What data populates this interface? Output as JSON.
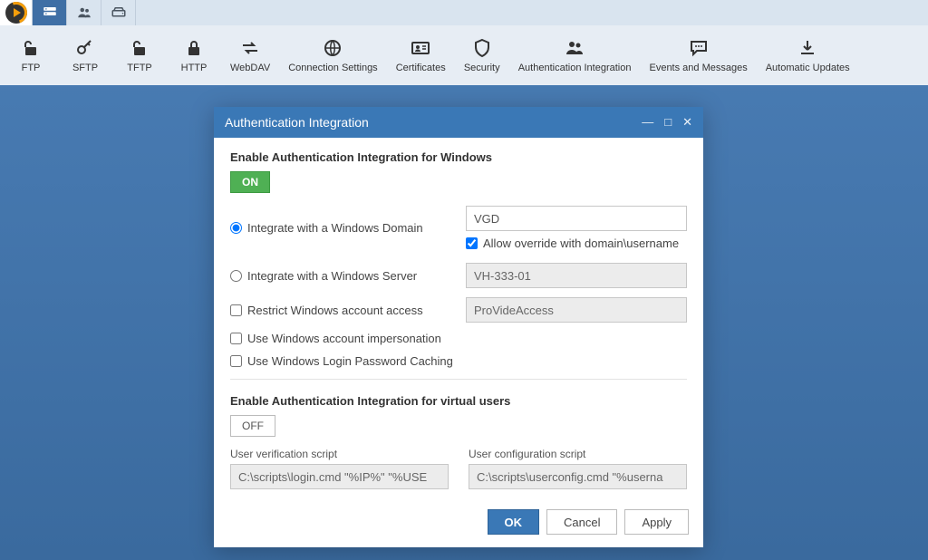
{
  "top_tabs": {
    "logo": "play-logo",
    "items": [
      "server-tab",
      "users-tab",
      "storage-tab"
    ]
  },
  "toolbar": {
    "items": [
      {
        "label": "FTP",
        "icon": "unlock"
      },
      {
        "label": "SFTP",
        "icon": "key"
      },
      {
        "label": "TFTP",
        "icon": "unlock"
      },
      {
        "label": "HTTP",
        "icon": "lock"
      },
      {
        "label": "WebDAV",
        "icon": "transfer"
      },
      {
        "label": "Connection Settings",
        "icon": "globe"
      },
      {
        "label": "Certificates",
        "icon": "id-card"
      },
      {
        "label": "Security",
        "icon": "shield"
      },
      {
        "label": "Authentication Integration",
        "icon": "users"
      },
      {
        "label": "Events and Messages",
        "icon": "chat"
      },
      {
        "label": "Automatic Updates",
        "icon": "download"
      }
    ]
  },
  "dialog": {
    "title": "Authentication Integration",
    "windows_section_header": "Enable Authentication Integration for Windows",
    "windows_toggle": "ON",
    "radios": {
      "domain_label": "Integrate with a Windows Domain",
      "server_label": "Integrate with a Windows Server"
    },
    "domain_value": "VGD",
    "allow_override_label": "Allow override with domain\\username",
    "allow_override_checked": true,
    "server_value": "VH-333-01",
    "restrict_label": "Restrict Windows account access",
    "restrict_value": "ProVideAccess",
    "impersonation_label": "Use Windows account impersonation",
    "cache_label": "Use Windows Login Password Caching",
    "virtual_section_header": "Enable Authentication Integration for virtual users",
    "virtual_toggle": "OFF",
    "verif_label": "User verification script",
    "verif_value": "C:\\scripts\\login.cmd \"%IP%\" \"%USE",
    "config_label": "User configuration script",
    "config_value": "C:\\scripts\\userconfig.cmd \"%userna",
    "buttons": {
      "ok": "OK",
      "cancel": "Cancel",
      "apply": "Apply"
    }
  }
}
